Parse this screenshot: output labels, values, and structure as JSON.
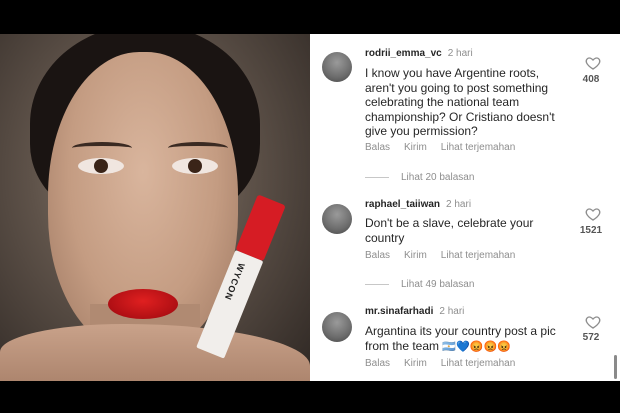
{
  "comments": [
    {
      "username": "rodrii_emma_vc",
      "time": "2 hari",
      "text": "I know you have Argentine roots, aren't you going to post something celebrating the national team championship? Or Cristiano doesn't give you permission?",
      "likes": "408",
      "reply_label": "Balas",
      "send_label": "Kirim",
      "translate_label": "Lihat terjemahan",
      "view_replies": "Lihat 20 balasan"
    },
    {
      "username": "raphael_taiiwan",
      "time": "2 hari",
      "text": "Don't be a slave, celebrate your country",
      "likes": "1521",
      "reply_label": "Balas",
      "send_label": "Kirim",
      "translate_label": "Lihat terjemahan",
      "view_replies": "Lihat 49 balasan"
    },
    {
      "username": "mr.sinafarhadi",
      "time": "2 hari",
      "text": "Argantina its your country post a pic from the team",
      "emojis": "🇦🇷💙😡😡😡",
      "likes": "572",
      "reply_label": "Balas",
      "send_label": "Kirim",
      "translate_label": "Lihat terjemahan"
    }
  ],
  "product": {
    "brand_text": "WYCON"
  },
  "icons": {
    "like": "heart-outline-icon"
  },
  "colors": {
    "lipstick": "#d61c24",
    "meta_text": "#8e8e8e",
    "text": "#262626"
  }
}
